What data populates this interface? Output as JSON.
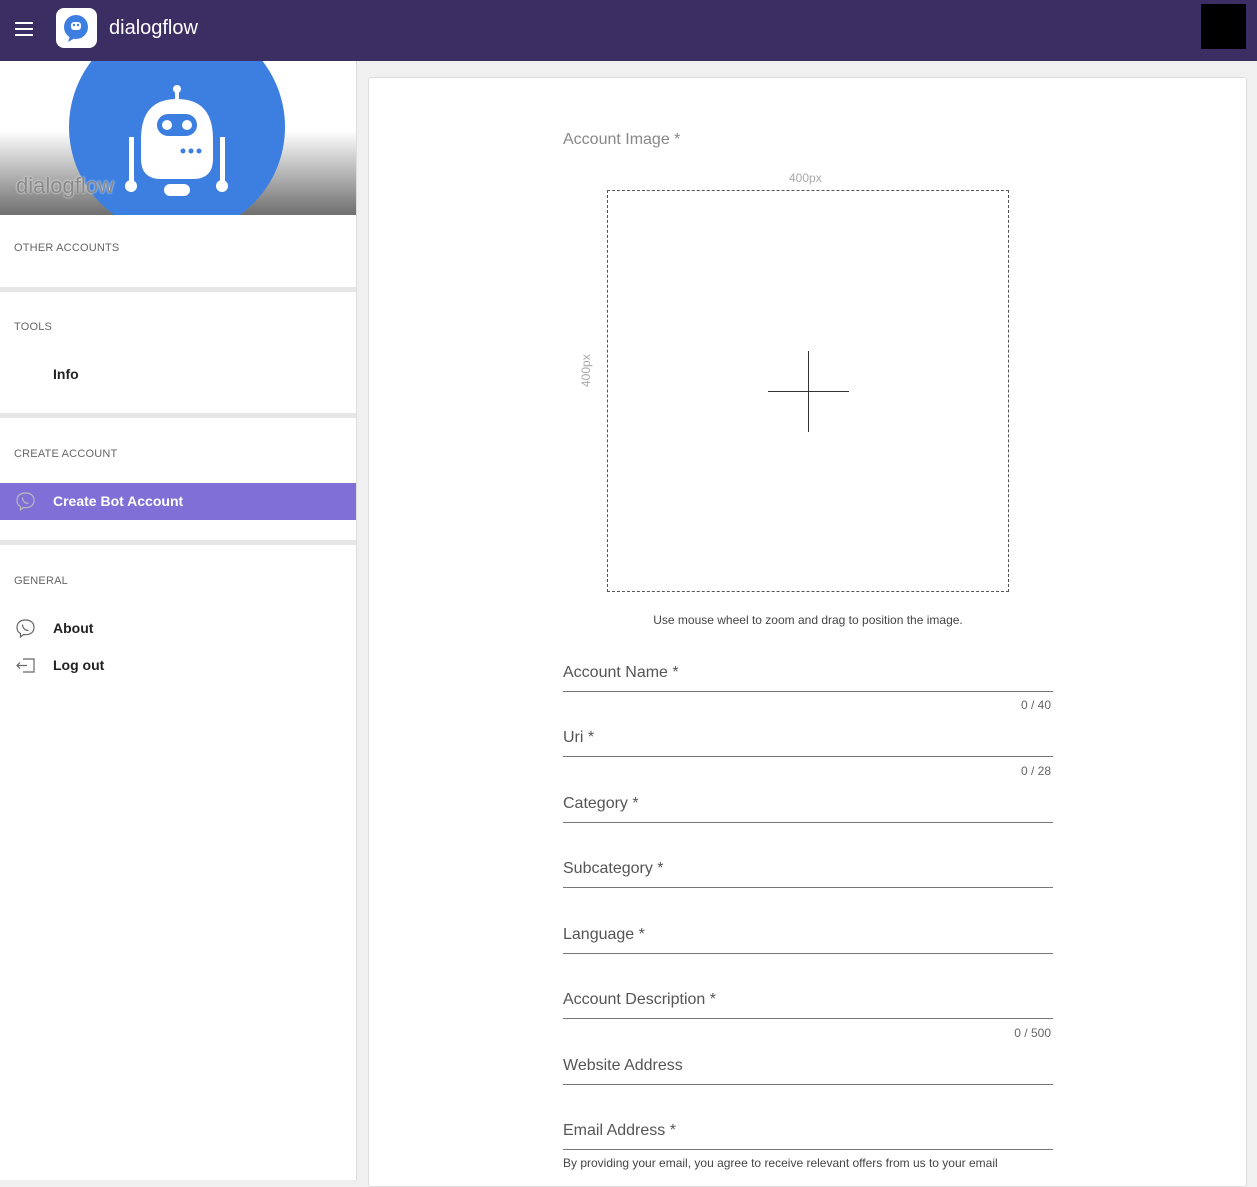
{
  "header": {
    "app_title": "dialogflow",
    "menu_icon": "hamburger-menu-icon",
    "logo_icon": "dialogflow-logo-icon"
  },
  "sidebar": {
    "profile_name": "dialogflow",
    "sections": {
      "other_accounts": "OTHER ACCOUNTS",
      "tools": "TOOLS",
      "create_account": "CREATE ACCOUNT",
      "general": "GENERAL"
    },
    "items": {
      "info": "Info",
      "create_bot": "Create Bot Account",
      "about": "About",
      "logout": "Log out"
    }
  },
  "form": {
    "account_image_label": "Account Image *",
    "width_label": "400px",
    "height_label": "400px",
    "hint": "Use mouse wheel to zoom and drag to position the image.",
    "fields": {
      "account_name": "Account Name *",
      "uri": "Uri *",
      "category": "Category *",
      "subcategory": "Subcategory *",
      "language": "Language *",
      "description": "Account Description *",
      "website": "Website Address",
      "email": "Email Address *"
    },
    "counters": {
      "account_name": "0 / 40",
      "uri": "0 / 28",
      "description": "0 / 500"
    },
    "email_note": "By providing your email, you agree to receive relevant offers from us to your email"
  },
  "colors": {
    "topbar": "#3a2e63",
    "active_item": "#7f6fd6",
    "avatar_blue": "#3d7fe0"
  }
}
